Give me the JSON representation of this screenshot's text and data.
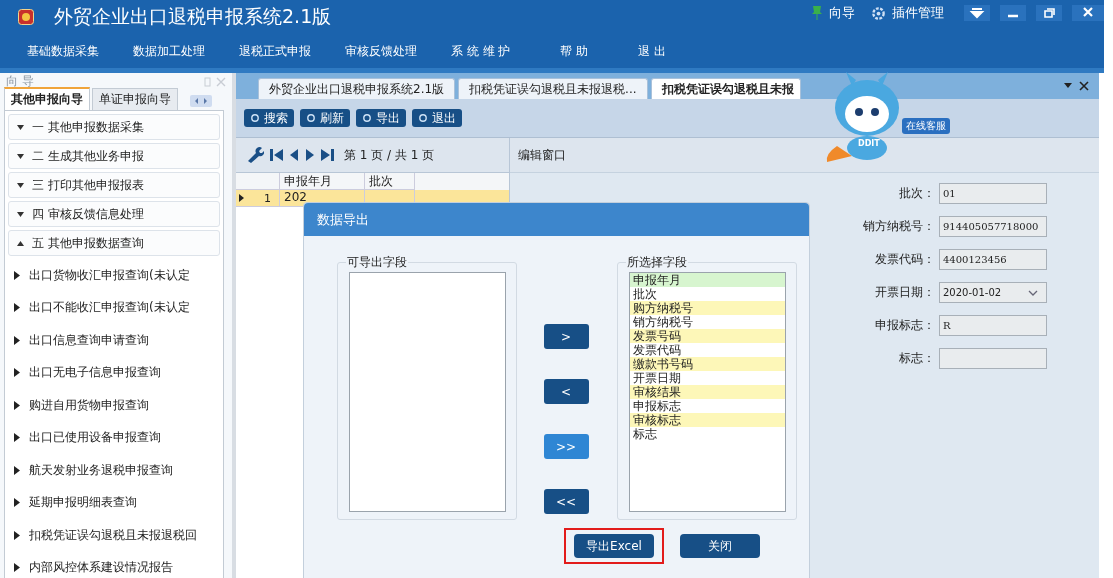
{
  "window": {
    "title": "外贸企业出口退税申报系统2.1版",
    "guide": "向导",
    "plugins": "插件管理"
  },
  "menu": [
    "基础数据采集",
    "数据加工处理",
    "退税正式申报",
    "审核反馈处理",
    "系 统 维 护",
    "帮 助",
    "退 出"
  ],
  "sidebar": {
    "title": "向 导",
    "tabs": [
      {
        "label": "其他申报向导",
        "selected": true
      },
      {
        "label": "单证申报向导",
        "selected": false
      }
    ],
    "sections": [
      {
        "label": "一 其他申报数据采集",
        "expanded": false
      },
      {
        "label": "二 生成其他业务申报",
        "expanded": false
      },
      {
        "label": "三 打印其他申报报表",
        "expanded": false
      },
      {
        "label": "四 审核反馈信息处理",
        "expanded": false
      },
      {
        "label": "五 其他申报数据查询",
        "expanded": true,
        "children": [
          "出口货物收汇申报查询(未认定",
          "出口不能收汇申报查询(未认定",
          "出口信息查询申请查询",
          "出口无电子信息申报查询",
          "购进自用货物申报查询",
          "出口已使用设备申报查询",
          "航天发射业务退税申报查询",
          "延期申报明细表查询",
          "扣税凭证误勾退税且未报退税回",
          "内部风控体系建设情况报告"
        ]
      }
    ]
  },
  "doc_tabs": [
    {
      "label": "外贸企业出口退税申报系统2.1版",
      "selected": false
    },
    {
      "label": "扣税凭证误勾退税且未报退税...",
      "selected": false
    },
    {
      "label": "扣税凭证误勾退税且未报",
      "selected": true
    }
  ],
  "toolbar": [
    "搜索",
    "刷新",
    "导出",
    "退出"
  ],
  "pager": {
    "text": "第 1 页 / 共 1 页"
  },
  "table": {
    "columns": [
      "申报年月",
      "批次"
    ],
    "rows": [
      {
        "index": "1",
        "cells": [
          "202",
          ""
        ],
        "selected": true
      }
    ]
  },
  "edit_panel": {
    "title": "编辑窗口",
    "fields": [
      {
        "label": "批次：",
        "value": "01",
        "kind": "text"
      },
      {
        "label": "销方纳税号：",
        "value": "914405057718000",
        "kind": "text"
      },
      {
        "label": "发票代码：",
        "value": "4400123456",
        "kind": "text"
      },
      {
        "label": "开票日期：",
        "value": "2020-01-02",
        "kind": "select"
      },
      {
        "label": "申报标志：",
        "value": "R",
        "kind": "text"
      },
      {
        "label": "标志：",
        "kind": "text"
      }
    ]
  },
  "mascot": {
    "badge": "在线客服",
    "logo": "DDIT"
  },
  "dialog": {
    "title": "数据导出",
    "available_title": "可导出字段",
    "selected_title": "所选择字段",
    "move_buttons": [
      ">",
      "<",
      ">>",
      "<<"
    ],
    "selected_fields": [
      {
        "label": "申报年月",
        "selected": true
      },
      {
        "label": "批次",
        "selected": false
      },
      {
        "label": "购方纳税号",
        "selected": false
      },
      {
        "label": "销方纳税号",
        "selected": false
      },
      {
        "label": "发票号码",
        "selected": false
      },
      {
        "label": "发票代码",
        "selected": false
      },
      {
        "label": "缴款书号码",
        "selected": false
      },
      {
        "label": "开票日期",
        "selected": false
      },
      {
        "label": "审核结果",
        "selected": false
      },
      {
        "label": "申报标志",
        "selected": false
      },
      {
        "label": "审核标志",
        "selected": false
      },
      {
        "label": "标志",
        "selected": false
      }
    ],
    "buttons": [
      {
        "label": "导出Excel",
        "highlighted": true
      },
      {
        "label": "关闭",
        "highlighted": false
      }
    ]
  }
}
